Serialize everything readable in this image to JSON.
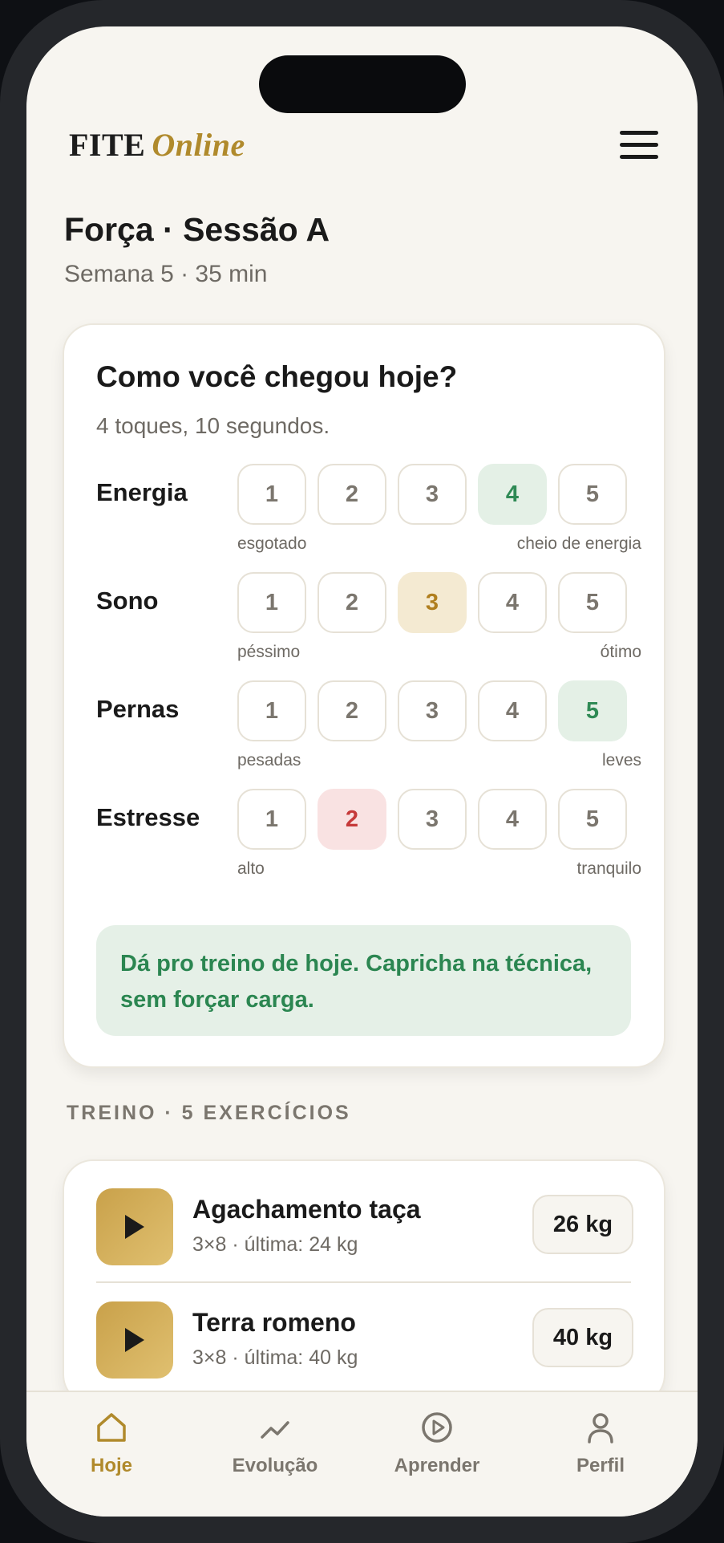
{
  "brand": {
    "name": "FITE",
    "accent": "Online"
  },
  "session": {
    "title": "Força · Sessão A",
    "subtitle": "Semana 5 · 35 min"
  },
  "checkin": {
    "title": "Como você chegou hoje?",
    "subtitle": "4 toques, 10 segundos.",
    "rows": [
      {
        "label": "Energia",
        "options": [
          "1",
          "2",
          "3",
          "4",
          "5"
        ],
        "selected": "4",
        "selected_color": "#2f8a55",
        "low": "esgotado",
        "high": "cheio de energia"
      },
      {
        "label": "Sono",
        "options": [
          "1",
          "2",
          "3",
          "4",
          "5"
        ],
        "selected": "3",
        "selected_color": "#b07f1f",
        "low": "péssimo",
        "high": "ótimo"
      },
      {
        "label": "Pernas",
        "options": [
          "1",
          "2",
          "3",
          "4",
          "5"
        ],
        "selected": "5",
        "selected_color": "#2f8a55",
        "low": "pesadas",
        "high": "leves"
      },
      {
        "label": "Estresse",
        "options": [
          "1",
          "2",
          "3",
          "4",
          "5"
        ],
        "selected": "2",
        "selected_color": "#c63a3a",
        "low": "alto",
        "high": "tranquilo"
      }
    ],
    "advice": "Dá pro treino de hoje. Capricha na técnica, sem forçar carga."
  },
  "workout": {
    "section_title": "TREINO · 5 EXERCÍCIOS",
    "exercises": [
      {
        "name": "Agachamento taça",
        "meta": "3×8 · última: 24 kg",
        "load": "26 kg"
      },
      {
        "name": "Terra romeno",
        "meta": "3×8 · última: 40 kg",
        "load": "40 kg"
      }
    ]
  },
  "tabs": [
    {
      "label": "Hoje",
      "icon": "home-icon",
      "active": true
    },
    {
      "label": "Evolução",
      "icon": "trend-icon",
      "active": false
    },
    {
      "label": "Aprender",
      "icon": "play-circle-icon",
      "active": false
    },
    {
      "label": "Perfil",
      "icon": "user-icon",
      "active": false
    }
  ],
  "colors": {
    "accent": "#b08a2c",
    "background": "#f7f5f0",
    "success": "#2b8651"
  }
}
